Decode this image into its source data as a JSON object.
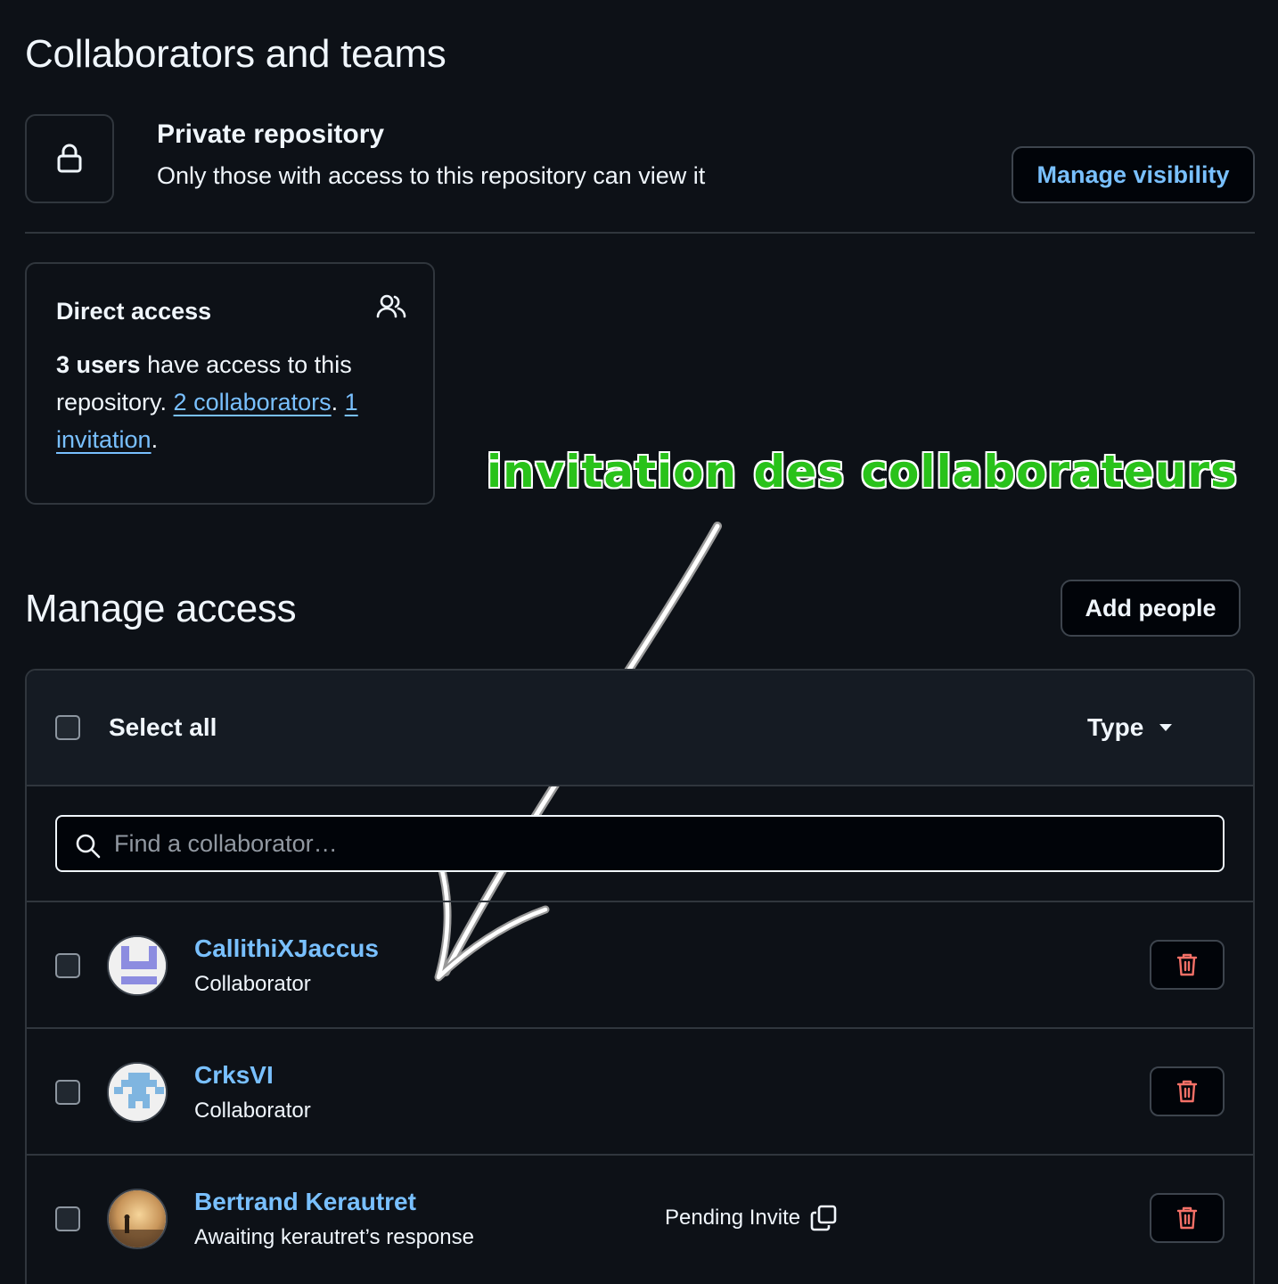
{
  "header": {
    "title": "Collaborators and teams"
  },
  "visibility": {
    "title": "Private repository",
    "description": "Only those with access to this repository can view it",
    "button_label": "Manage visibility",
    "icon": "lock-icon"
  },
  "direct_access": {
    "title": "Direct access",
    "icon": "people-icon",
    "count_text": "3 users",
    "text_1": " have access to this repository. ",
    "collaborators_link": "2 collaborators",
    "separator": ". ",
    "invitation_link": "1 invitation",
    "end": "."
  },
  "annotation": {
    "text": "invitation des collaborateurs",
    "color": "#29c21a"
  },
  "manage_access": {
    "title": "Manage access",
    "add_button": "Add people",
    "select_all": "Select all",
    "type_filter": "Type",
    "search": {
      "placeholder": "Find a collaborator…",
      "value": ""
    },
    "rows": [
      {
        "name": "CallithiXJaccus",
        "role": "Collaborator",
        "pending": ""
      },
      {
        "name": "CrksVI",
        "role": "Collaborator",
        "pending": ""
      },
      {
        "name": "Bertrand Kerautret",
        "role": "Awaiting kerautret’s response",
        "pending": "Pending Invite"
      }
    ]
  },
  "colors": {
    "link": "#79c0ff",
    "danger": "#f47067",
    "background": "#0d1117"
  }
}
